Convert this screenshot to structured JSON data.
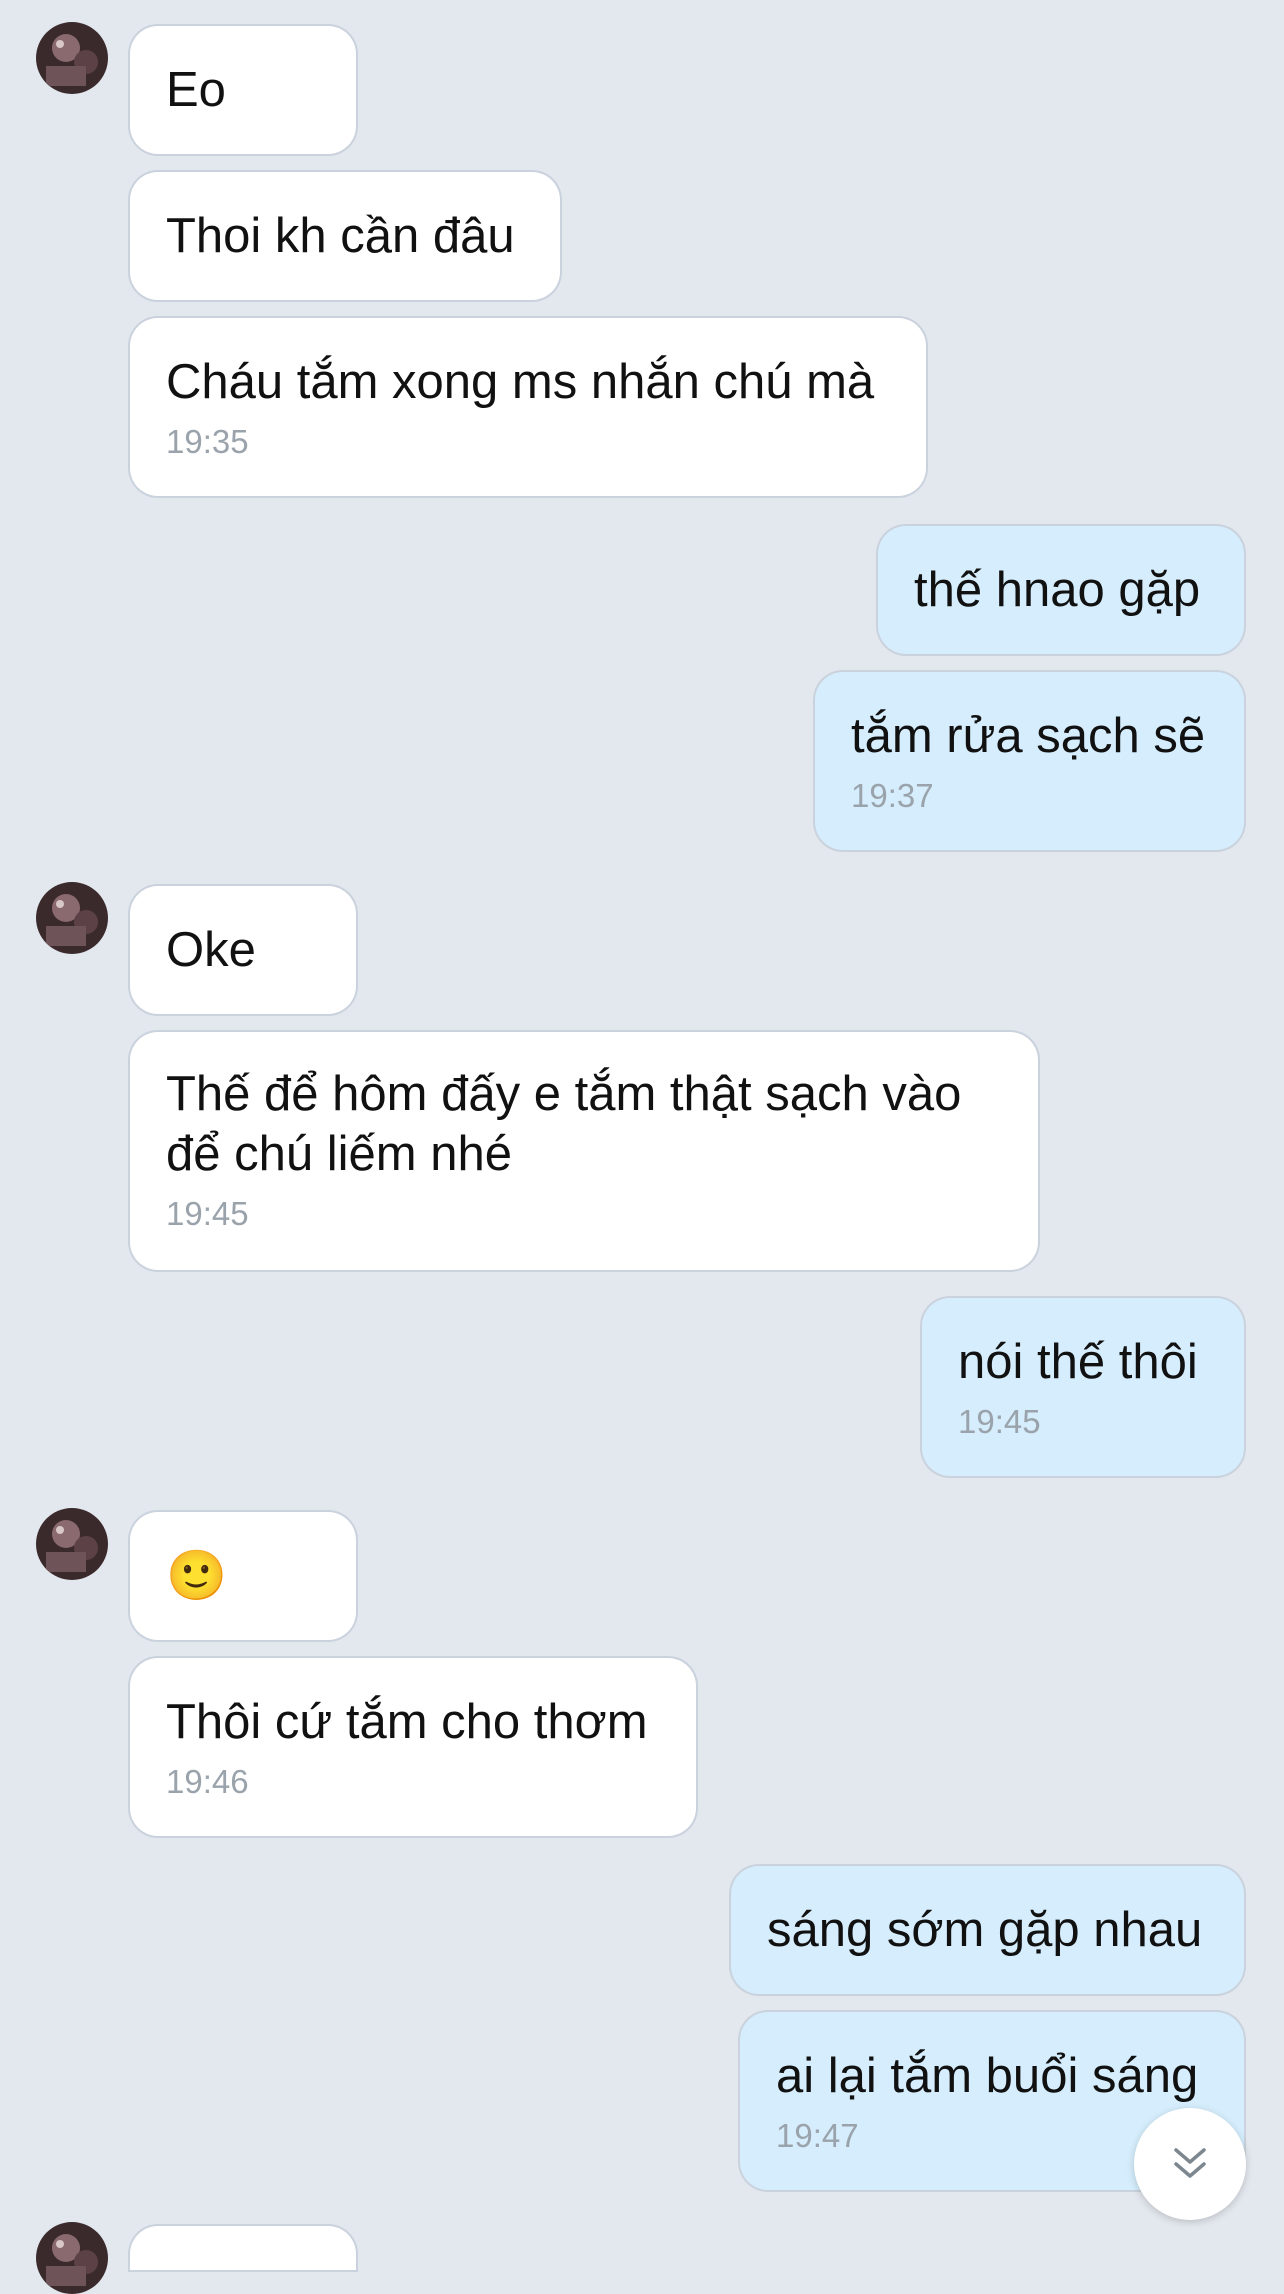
{
  "messages": [
    {
      "text": "Eo"
    },
    {
      "text": "Thoi kh cần đâu"
    },
    {
      "text": "Cháu tắm xong ms nhắn chú mà",
      "time": "19:35"
    },
    {
      "text": "thế hnao gặp"
    },
    {
      "text": "tắm rửa sạch sẽ",
      "time": "19:37"
    },
    {
      "text": "Oke"
    },
    {
      "text": "Thế để hôm đấy e tắm thật sạch vào\nđể chú liếm nhé",
      "time": "19:45"
    },
    {
      "text": "nói thế thôi",
      "time": "19:45"
    },
    {
      "text": "🙂"
    },
    {
      "text": "Thôi cứ tắm cho thơm",
      "time": "19:46"
    },
    {
      "text": "sáng sớm gặp nhau"
    },
    {
      "text": "ai lại tắm buổi sáng",
      "time": "19:47"
    }
  ],
  "icons": {
    "avatar": "avatar-icon",
    "scroll_down": "double-chevron-down-icon"
  },
  "colors": {
    "background": "#e3e8ee",
    "incoming_bubble": "#ffffff",
    "outgoing_bubble": "#d5edfc",
    "timestamp": "#9aa3ab"
  }
}
